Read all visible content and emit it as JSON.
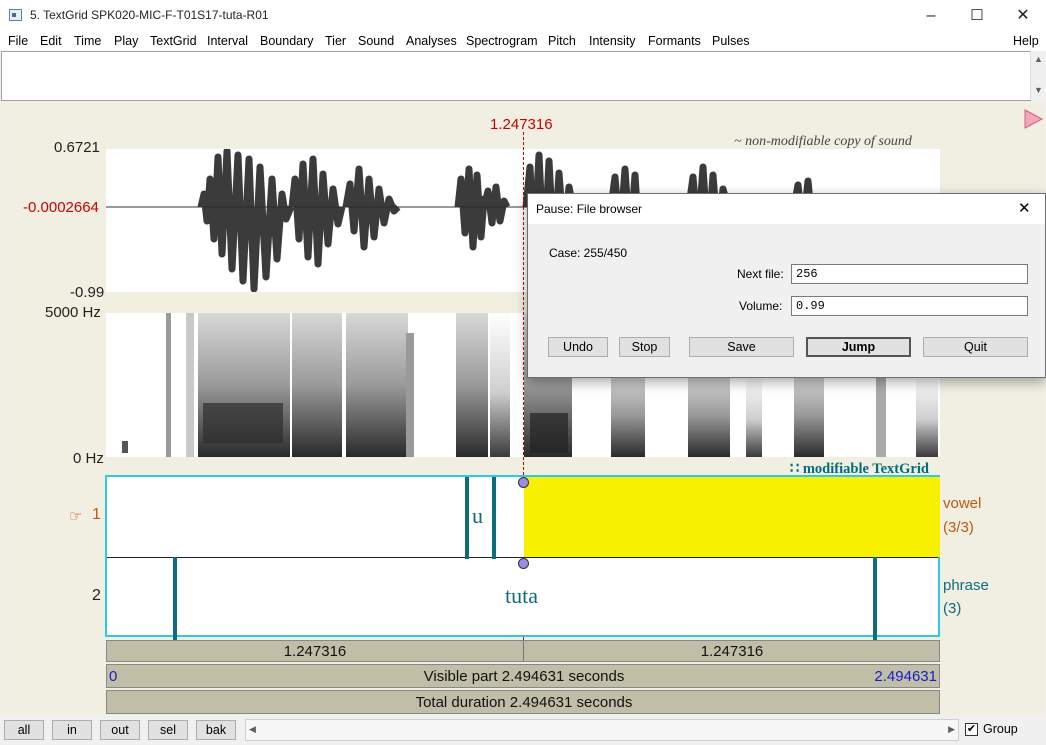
{
  "window": {
    "title": "5. TextGrid SPK020-MIC-F-T01S17-tuta-R01",
    "controls": {
      "minimize": "–",
      "maximize": "☐",
      "close": "✕"
    }
  },
  "menu": [
    "File",
    "Edit",
    "Time",
    "Play",
    "TextGrid",
    "Interval",
    "Boundary",
    "Tier",
    "Sound",
    "Analyses",
    "Spectrogram",
    "Pitch",
    "Intensity",
    "Formants",
    "Pulses"
  ],
  "menu_help": "Help",
  "editor": {
    "cursor_time": "1.247316",
    "sound_note": "~ non-modifiable copy of sound",
    "amp_max": "0.6721",
    "amp_cursor": "-0.0002664",
    "amp_min": "-0.99",
    "freq_max": "5000 Hz",
    "freq_min": "0 Hz",
    "textgrid_note": "∷ modifiable TextGrid",
    "tiers": [
      {
        "number": "1",
        "pointer": "☞",
        "name": "vowel",
        "count": "(3/3)",
        "interval_label": "u"
      },
      {
        "number": "2",
        "name": "phrase",
        "count": "(3)",
        "interval_label": "tuta"
      }
    ],
    "time_left": "1.247316",
    "time_right": "1.247316",
    "visible_start": "0",
    "visible_end": "2.494631",
    "visible_part": "Visible part 2.494631 seconds",
    "total_duration": "Total duration 2.494631 seconds"
  },
  "colors": {
    "selection": "#f7f000",
    "tier_border": "#2ec8ea",
    "boundary": "#0f6c80",
    "cursor": "#cc0000"
  },
  "dialog": {
    "title": "Pause: File browser",
    "close": "✕",
    "case_label": "Case: 255/450",
    "next_file_label": "Next file:",
    "next_file_value": "256",
    "volume_label": "Volume:",
    "volume_value": "0.99",
    "buttons": {
      "undo": "Undo",
      "stop": "Stop",
      "save": "Save",
      "jump": "Jump",
      "quit": "Quit"
    }
  },
  "bottom": {
    "zoom_buttons": [
      "all",
      "in",
      "out",
      "sel",
      "bak"
    ],
    "group_label": "Group",
    "group_checked": true,
    "check_mark": "✔"
  }
}
